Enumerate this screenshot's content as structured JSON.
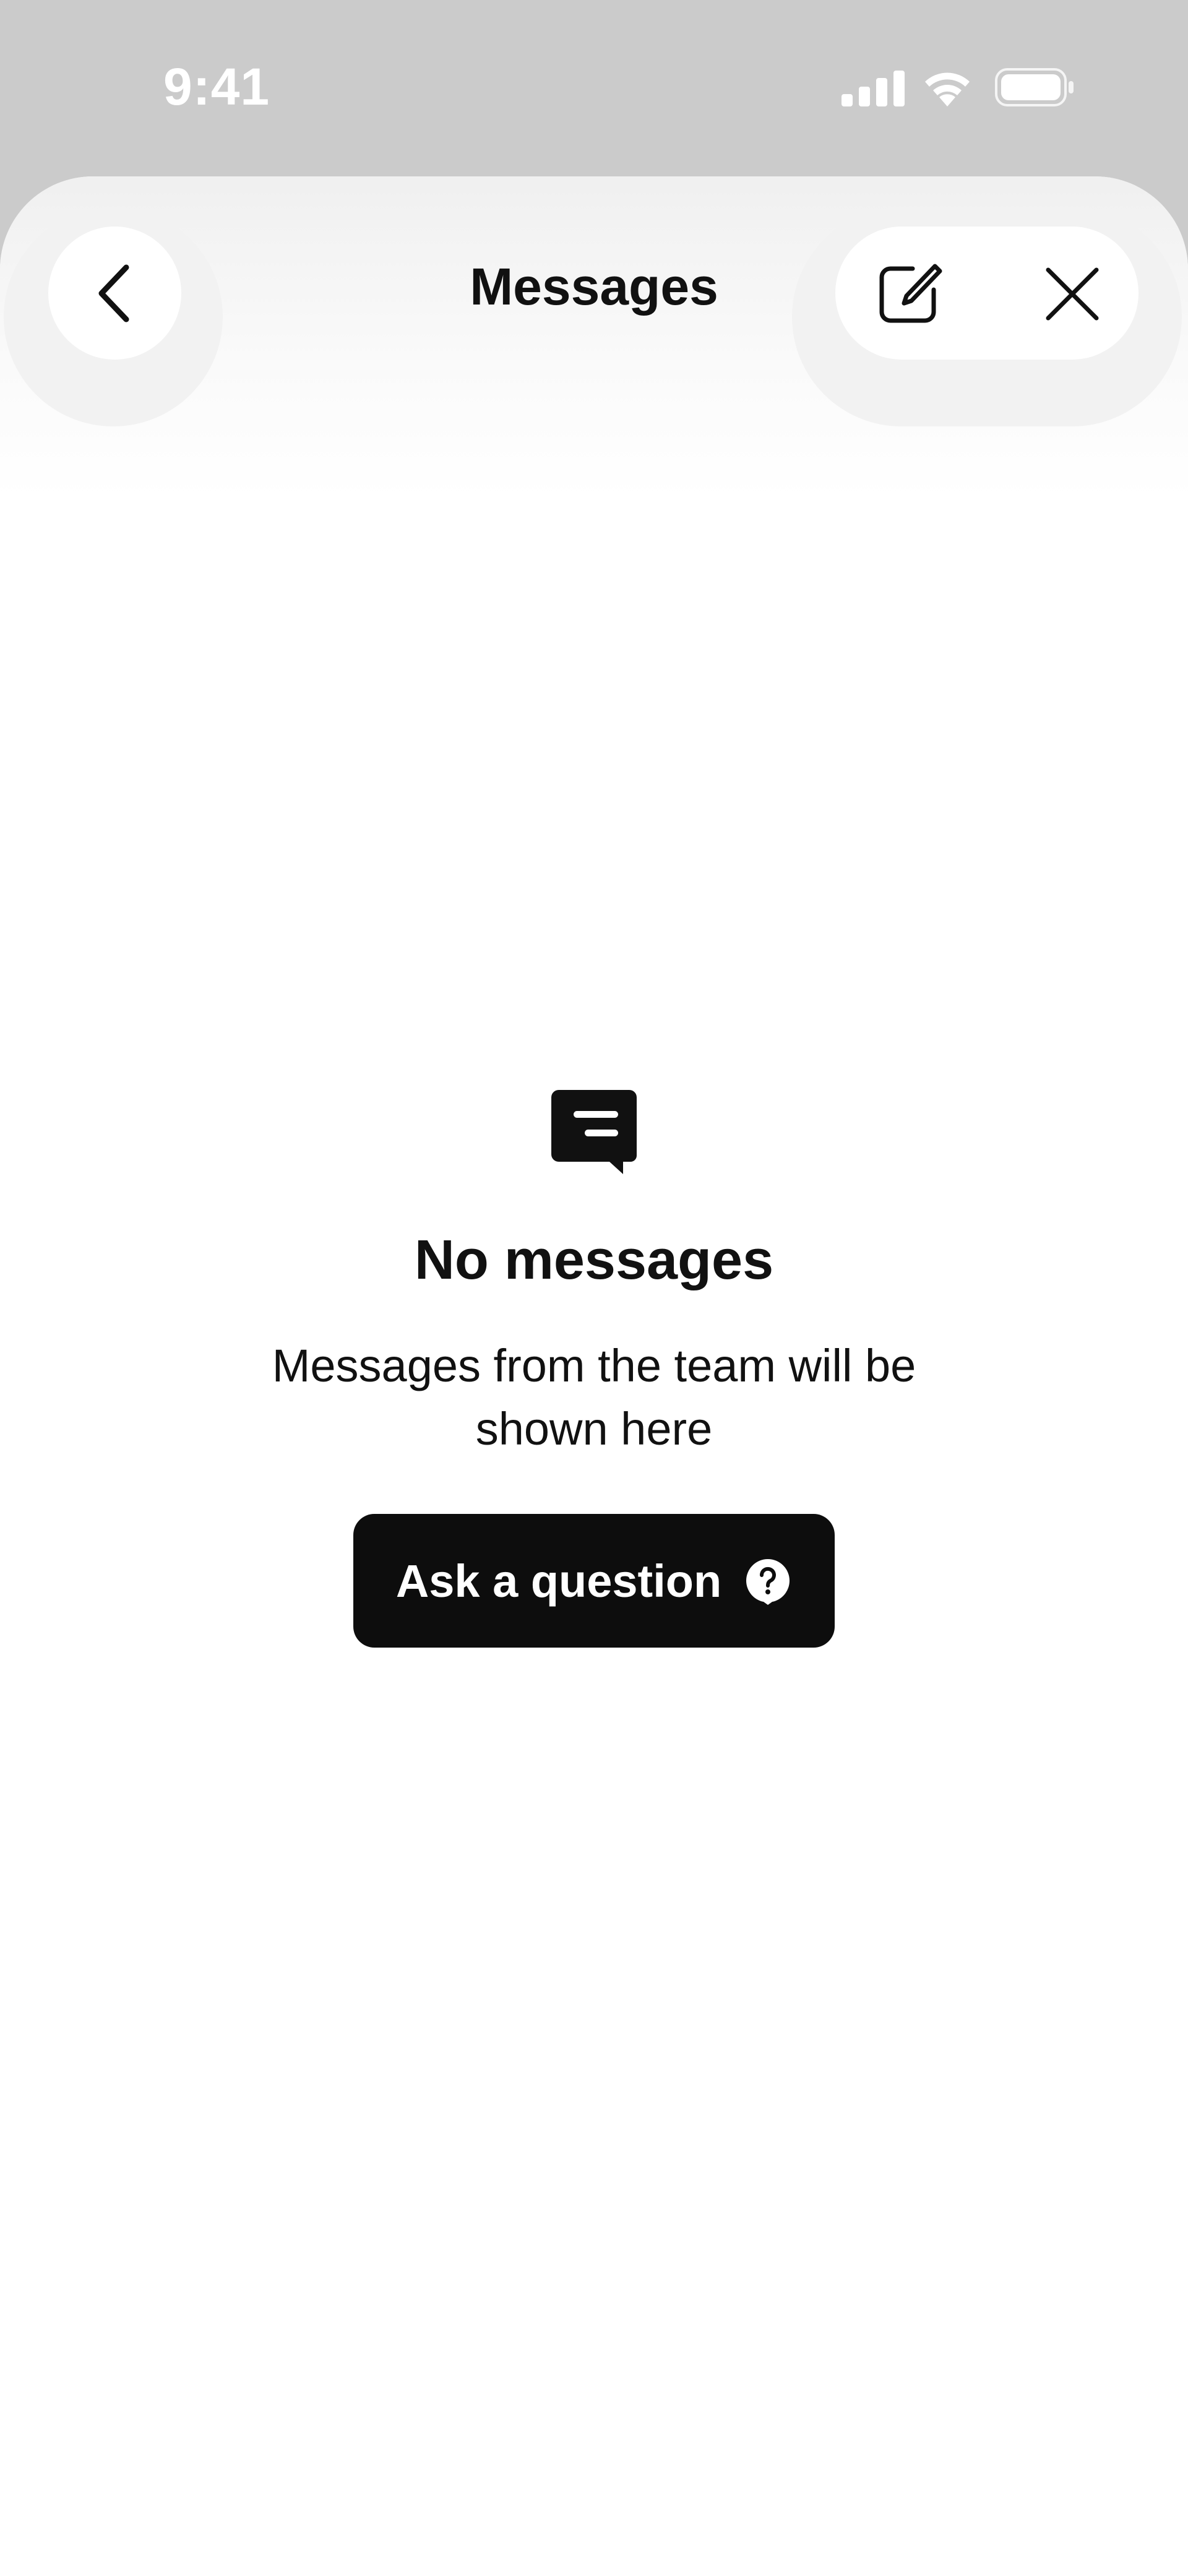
{
  "status_bar": {
    "time": "9:41",
    "icons": [
      "cellular-signal-icon",
      "wifi-icon",
      "battery-icon"
    ]
  },
  "header": {
    "title": "Messages",
    "back_icon": "chevron-left-icon",
    "compose_icon": "compose-icon",
    "close_icon": "close-icon"
  },
  "empty_state": {
    "icon": "chat-bubble-icon",
    "title": "No messages",
    "description": "Messages from the team will be shown here",
    "button_label": "Ask a question",
    "button_icon": "question-bubble-icon"
  },
  "colors": {
    "backdrop": "#cbcbcb",
    "sheet": "#ffffff",
    "text": "#111111",
    "button": "#0d0d0d",
    "button_text": "#ffffff"
  }
}
